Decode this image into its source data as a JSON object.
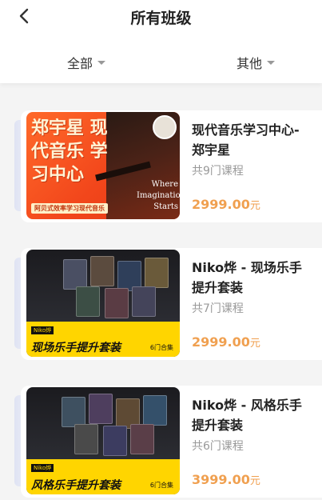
{
  "header": {
    "title": "所有班级",
    "filters": [
      {
        "label": "全部"
      },
      {
        "label": "其他"
      }
    ]
  },
  "courses": [
    {
      "name": "现代音乐学习中心-郑宇星",
      "count": "共9门课程",
      "price": "2999.00",
      "unit": "元",
      "thumb": {
        "headline": "郑宇星 现代音乐 学习中心",
        "tagline": "Where Imagination Starts",
        "strip": "阿贝式效率学习现代音乐"
      }
    },
    {
      "name": "Niko烨 - 现场乐手提升套装",
      "count": "共7门课程",
      "price": "2999.00",
      "unit": "元",
      "thumb": {
        "tag": "Niko烨",
        "banner": "现场乐手提升套装",
        "bundle": "6门合集"
      }
    },
    {
      "name": "Niko烨 - 风格乐手提升套装",
      "count": "共6门课程",
      "price": "3999.00",
      "unit": "元",
      "thumb": {
        "tag": "Niko烨",
        "banner": "风格乐手提升套装",
        "bundle": "6门合集"
      }
    }
  ]
}
